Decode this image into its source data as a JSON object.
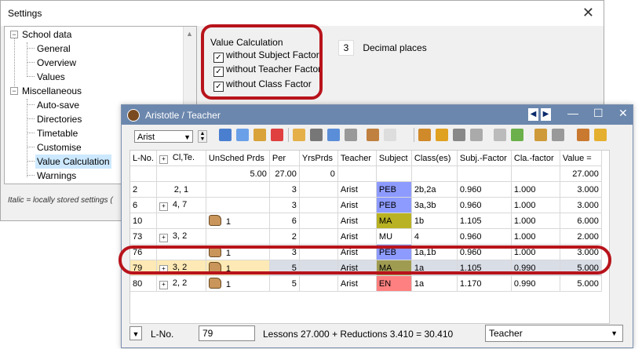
{
  "settings": {
    "title": "Settings",
    "tree": [
      {
        "label": "School data"
      },
      {
        "label": "General"
      },
      {
        "label": "Overview"
      },
      {
        "label": "Values"
      },
      {
        "label": "Miscellaneous"
      },
      {
        "label": "Auto-save"
      },
      {
        "label": "Directories"
      },
      {
        "label": "Timetable"
      },
      {
        "label": "Customise"
      },
      {
        "label": "Value Calculation"
      },
      {
        "label": "Warnings"
      }
    ],
    "note": "Italic = locally stored settings (",
    "value_calc": {
      "legend": "Value Calculation",
      "options": [
        "without Subject Factor",
        "without Teacher Factor",
        "without Class Factor"
      ]
    },
    "decimals": {
      "value": "3",
      "label": "Decimal places"
    }
  },
  "aristotle": {
    "title": "Aristotle / Teacher",
    "combo_value": "Arist",
    "columns": [
      "L-No.",
      "Cl,Te.",
      "UnSched Prds",
      "Per",
      "YrsPrds",
      "Teacher",
      "Subject",
      "Class(es)",
      "Subj.-Factor",
      "Cla.-factor",
      "Value ="
    ],
    "sum_row": [
      "",
      "",
      "5.00",
      "27.00",
      "0",
      "",
      "",
      "",
      "",
      "",
      "27.000"
    ],
    "rows": [
      [
        "2",
        "2, 1",
        "",
        "3",
        "",
        "Arist",
        "PEB",
        "2b,2a",
        "0.960",
        "1.000",
        "3.000"
      ],
      [
        "6",
        "4, 7",
        "",
        "3",
        "",
        "Arist",
        "PEB",
        "3a,3b",
        "0.960",
        "1.000",
        "3.000"
      ],
      [
        "10",
        "",
        "1",
        "6",
        "",
        "Arist",
        "MA",
        "1b",
        "1.105",
        "1.000",
        "6.000"
      ],
      [
        "73",
        "3, 2",
        "",
        "2",
        "",
        "Arist",
        "MU",
        "4",
        "0.960",
        "1.000",
        "2.000"
      ],
      [
        "76",
        "",
        "1",
        "3",
        "",
        "Arist",
        "PEB",
        "1a,1b",
        "0.960",
        "1.000",
        "3.000"
      ],
      [
        "79",
        "3, 2",
        "1",
        "5",
        "",
        "Arist",
        "MA",
        "1a",
        "1.105",
        "0.990",
        "5.000"
      ],
      [
        "80",
        "2, 2",
        "1",
        "5",
        "",
        "Arist",
        "EN",
        "1a",
        "1.170",
        "0.990",
        "5.000"
      ]
    ],
    "status": {
      "lno_label": "L-No.",
      "lno_value": "79",
      "summary": "Lessons 27.000 + Reductions 3.410 = 30.410",
      "view": "Teacher"
    }
  },
  "colors": {
    "highlight": "#b8131b",
    "titlebar": "#6b87ad"
  }
}
